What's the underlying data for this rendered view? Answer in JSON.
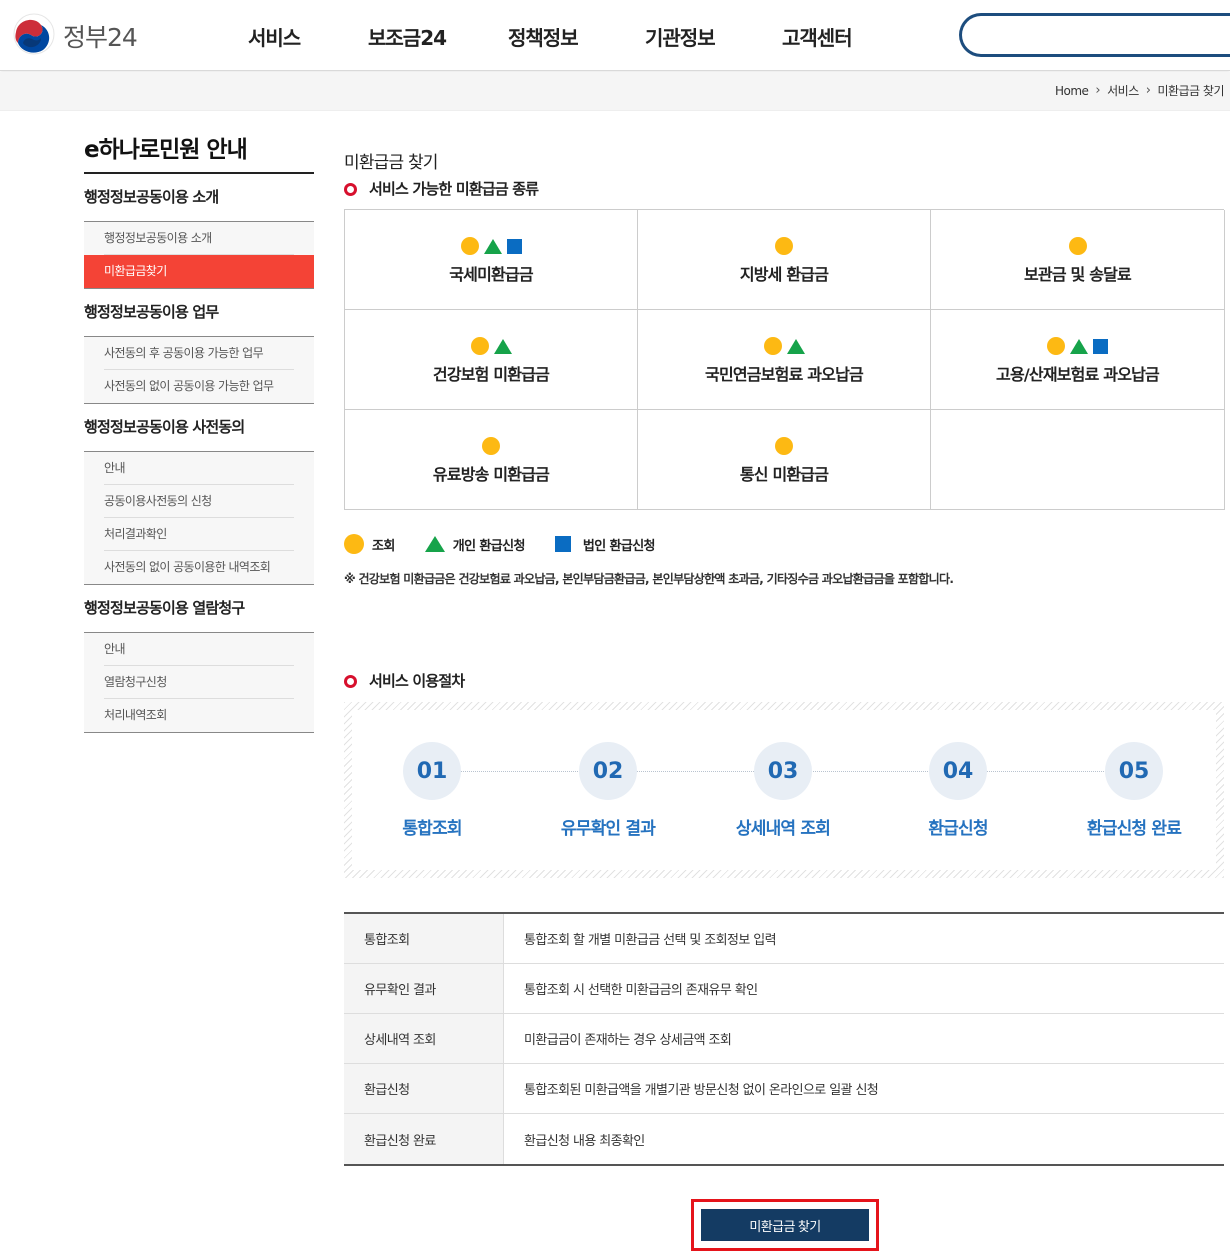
{
  "header": {
    "logo_text": "정부24",
    "nav": [
      "서비스",
      "보조금24",
      "정책정보",
      "기관정보",
      "고객센터"
    ],
    "search_placeholder": ""
  },
  "breadcrumb": [
    "Home",
    "서비스",
    "미환급금 찾기"
  ],
  "sidebar": {
    "title": "e하나로민원 안내",
    "groups": [
      {
        "label": "행정정보공동이용 소개",
        "items": [
          "행정정보공동이용 소개",
          "미환급금찾기"
        ]
      },
      {
        "label": "행정정보공동이용 업무",
        "items": [
          "사전동의 후 공동이용 가능한 업무",
          "사전동의 없이 공동이용 가능한 업무"
        ]
      },
      {
        "label": "행정정보공동이용 사전동의",
        "items": [
          "안내",
          "공동이용사전동의 신청",
          "처리결과확인",
          "사전동의 없이 공동이용한 내역조회"
        ]
      },
      {
        "label": "행정정보공동이용 열람청구",
        "items": [
          "안내",
          "열람청구신청",
          "처리내역조회"
        ]
      }
    ],
    "active_item": "미환급금찾기"
  },
  "main": {
    "page_title": "미환급금 찾기",
    "section1_title": "서비스 가능한 미환급금 종류",
    "refund_types": [
      {
        "label": "국세미환급금",
        "marks": [
          "circle",
          "triangle",
          "square"
        ]
      },
      {
        "label": "지방세 환급금",
        "marks": [
          "circle"
        ]
      },
      {
        "label": "보관금 및 송달료",
        "marks": [
          "circle"
        ]
      },
      {
        "label": "건강보험 미환급금",
        "marks": [
          "circle",
          "triangle"
        ]
      },
      {
        "label": "국민연금보험료 과오납금",
        "marks": [
          "circle",
          "triangle"
        ]
      },
      {
        "label": "고용/산재보험료 과오납금",
        "marks": [
          "circle",
          "triangle",
          "square"
        ]
      },
      {
        "label": "유료방송 미환급금",
        "marks": [
          "circle"
        ]
      },
      {
        "label": "통신 미환급금",
        "marks": [
          "circle"
        ]
      }
    ],
    "legend": {
      "circle": "조회",
      "triangle": "개인 환급신청",
      "square": "법인 환급신청"
    },
    "note": "※ 건강보험 미환급금은 건강보험료 과오납금, 본인부담금환급금, 본인부담상한액 초과금, 기타징수금 과오납환급금을 포함합니다.",
    "section2_title": "서비스 이용절차",
    "steps": [
      {
        "num": "01",
        "label": "통합조회"
      },
      {
        "num": "02",
        "label": "유무확인 결과"
      },
      {
        "num": "03",
        "label": "상세내역 조회"
      },
      {
        "num": "04",
        "label": "환급신청"
      },
      {
        "num": "05",
        "label": "환급신청 완료"
      }
    ],
    "table": [
      {
        "head": "통합조회",
        "desc": "통합조회 할 개별 미환급금 선택 및 조회정보 입력"
      },
      {
        "head": "유무확인 결과",
        "desc": "통합조회 시 선택한 미환급금의 존재유무 확인"
      },
      {
        "head": "상세내역 조회",
        "desc": "미환급금이 존재하는 경우 상세금액 조회"
      },
      {
        "head": "환급신청",
        "desc": "통합조회된 미환급액을 개별기관 방문신청 없이 온라인으로 일괄 신청"
      },
      {
        "head": "환급신청 완료",
        "desc": "환급신청 내용 최종확인"
      }
    ],
    "button_label": "미환급금 찾기"
  },
  "colors": {
    "accent_red": "#f44336",
    "bullet_red": "#d7102d",
    "circle_mark": "#fdb913",
    "triangle_mark": "#16a34a",
    "square_mark": "#0a6cc2",
    "step_blue": "#2673c0",
    "button_navy": "#143b63",
    "highlight_border": "#e5141b"
  }
}
